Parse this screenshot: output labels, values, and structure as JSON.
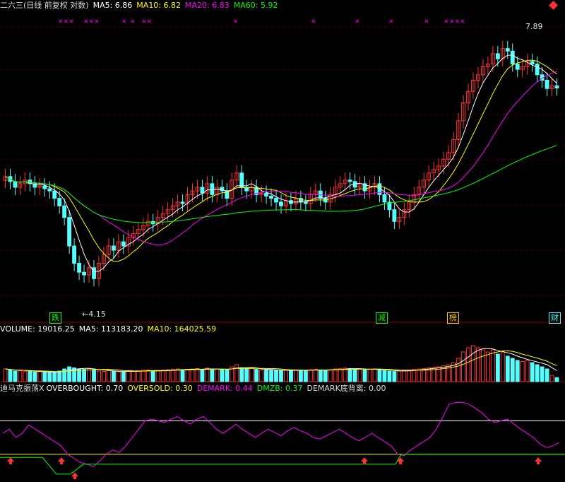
{
  "colors": {
    "bg": "#000000",
    "up": "#ff3232",
    "down": "#54ffff",
    "ma5": "#ffffff",
    "ma10": "#ffff00",
    "ma20": "#ff00ff",
    "ma60": "#00ff00",
    "grid": "#8b0000",
    "line_white": "#ffffff",
    "line_green": "#00ff00",
    "line_magenta": "#ff00ff"
  },
  "header": {
    "title": "二六三(日线 前复权 对数)",
    "ma5": "MA5: 6.86",
    "ma10": "MA10: 6.82",
    "ma20": "MA20: 6.83",
    "ma60": "MA60: 5.92"
  },
  "price_panel": {
    "high_label": "7.89",
    "low_label": "4.15",
    "arrow_glyph": "←",
    "top_right_icon": "diamond-icon",
    "markers": [
      "×××",
      "×××",
      "×",
      "×",
      "××",
      "×",
      "×",
      "×",
      "×",
      "×",
      "×",
      "×××"
    ],
    "events": [
      {
        "text": "跌",
        "color": "#00ff00"
      },
      {
        "text": "减",
        "color": "#00ff00"
      },
      {
        "text": "榜",
        "color": "#ffcc00"
      },
      {
        "text": "财",
        "color": "#54ffff"
      }
    ]
  },
  "volume_panel": {
    "volume": "VOLUME: 19016.25",
    "ma5": "MA5: 113183.20",
    "ma10": "MA10: 164025.59"
  },
  "indicator_panel": {
    "name": "迪马克振荡X",
    "overbought": "OVERBOUGHT: 0.70",
    "oversold": "OVERSOLD: 0.30",
    "demark": "DEMARK: 0.44",
    "dmzb": "DMZB: 0.37",
    "divergence": "DEMARK底背离: 0.00",
    "arrow_icon": "up-arrow-icon",
    "overbought_value": 0.7,
    "oversold_value": 0.3
  },
  "chart_data": {
    "type": "candlestick",
    "ylim": [
      3.9,
      8.1
    ],
    "log_scale": true,
    "high": 7.89,
    "low": 4.15,
    "last_ma": {
      "ma5": 6.86,
      "ma10": 6.82,
      "ma20": 6.83,
      "ma60": 5.92
    },
    "closes": [
      5.45,
      5.38,
      5.3,
      5.35,
      5.4,
      5.35,
      5.3,
      5.32,
      5.28,
      5.25,
      5.15,
      5.05,
      4.9,
      4.55,
      4.35,
      4.25,
      4.22,
      4.3,
      4.18,
      4.35,
      4.45,
      4.55,
      4.5,
      4.6,
      4.55,
      4.65,
      4.7,
      4.75,
      4.8,
      4.85,
      4.82,
      4.9,
      4.95,
      5.0,
      5.05,
      5.1,
      5.08,
      5.2,
      5.25,
      5.3,
      5.22,
      5.35,
      5.2,
      5.3,
      5.25,
      5.15,
      5.4,
      5.5,
      5.3,
      5.25,
      5.3,
      5.2,
      5.22,
      5.18,
      5.15,
      5.1,
      5.05,
      5.12,
      5.08,
      5.15,
      5.1,
      5.08,
      5.2,
      5.25,
      5.15,
      5.1,
      5.2,
      5.3,
      5.35,
      5.4,
      5.38,
      5.3,
      5.35,
      5.25,
      5.3,
      5.35,
      5.2,
      5.1,
      5.0,
      4.85,
      4.9,
      5.0,
      5.1,
      5.2,
      5.3,
      5.4,
      5.5,
      5.55,
      5.6,
      5.7,
      5.8,
      6.0,
      6.3,
      6.6,
      6.8,
      7.0,
      7.1,
      7.25,
      7.3,
      7.5,
      7.4,
      7.6,
      7.55,
      7.3,
      7.2,
      7.25,
      7.35,
      7.3,
      7.1,
      7.0,
      6.85,
      6.9,
      6.86
    ],
    "volume_scale_max": 220000,
    "volumes_approx": [
      60000,
      55000,
      50000,
      52000,
      48000,
      50000,
      45000,
      47000,
      44000,
      43000,
      45000,
      50000,
      60000,
      70000,
      65000,
      60000,
      58000,
      62000,
      55000,
      50000,
      48000,
      52000,
      50000,
      47000,
      46000,
      48000,
      50000,
      52000,
      54000,
      55000,
      50000,
      52000,
      54000,
      56000,
      58000,
      60000,
      55000,
      58000,
      60000,
      62000,
      58000,
      64000,
      56000,
      60000,
      58000,
      55000,
      70000,
      80000,
      65000,
      60000,
      62000,
      58000,
      57000,
      55000,
      54000,
      53000,
      52000,
      54000,
      53000,
      55000,
      54000,
      53000,
      56000,
      58000,
      55000,
      53000,
      56000,
      60000,
      62000,
      64000,
      62000,
      58000,
      60000,
      56000,
      58000,
      60000,
      55000,
      52000,
      50000,
      48000,
      50000,
      52000,
      55000,
      58000,
      60000,
      62000,
      65000,
      68000,
      70000,
      75000,
      80000,
      90000,
      110000,
      140000,
      160000,
      170000,
      160000,
      150000,
      140000,
      150000,
      130000,
      140000,
      120000,
      110000,
      100000,
      95000,
      100000,
      90000,
      80000,
      70000,
      60000,
      30000,
      19016.25
    ],
    "indicator_demark": [
      0.55,
      0.6,
      0.5,
      0.55,
      0.65,
      0.6,
      0.55,
      0.5,
      0.45,
      0.4,
      0.3,
      0.25,
      0.2,
      0.18,
      0.15,
      0.22,
      0.3,
      0.35,
      0.32,
      0.4,
      0.5,
      0.6,
      0.7,
      0.72,
      0.7,
      0.68,
      0.72,
      0.75,
      0.7,
      0.66,
      0.72,
      0.75,
      0.68,
      0.6,
      0.55,
      0.6,
      0.66,
      0.6,
      0.55,
      0.5,
      0.55,
      0.6,
      0.56,
      0.52,
      0.58,
      0.62,
      0.58,
      0.55,
      0.5,
      0.48,
      0.52,
      0.56,
      0.6,
      0.55,
      0.5,
      0.46,
      0.5,
      0.55,
      0.5,
      0.45,
      0.4,
      0.3,
      0.28,
      0.35,
      0.4,
      0.45,
      0.5,
      0.6,
      0.75,
      0.9,
      0.92,
      0.92,
      0.9,
      0.85,
      0.8,
      0.72,
      0.68,
      0.7,
      0.72,
      0.66,
      0.6,
      0.55,
      0.5,
      0.42,
      0.38,
      0.4,
      0.44
    ]
  }
}
